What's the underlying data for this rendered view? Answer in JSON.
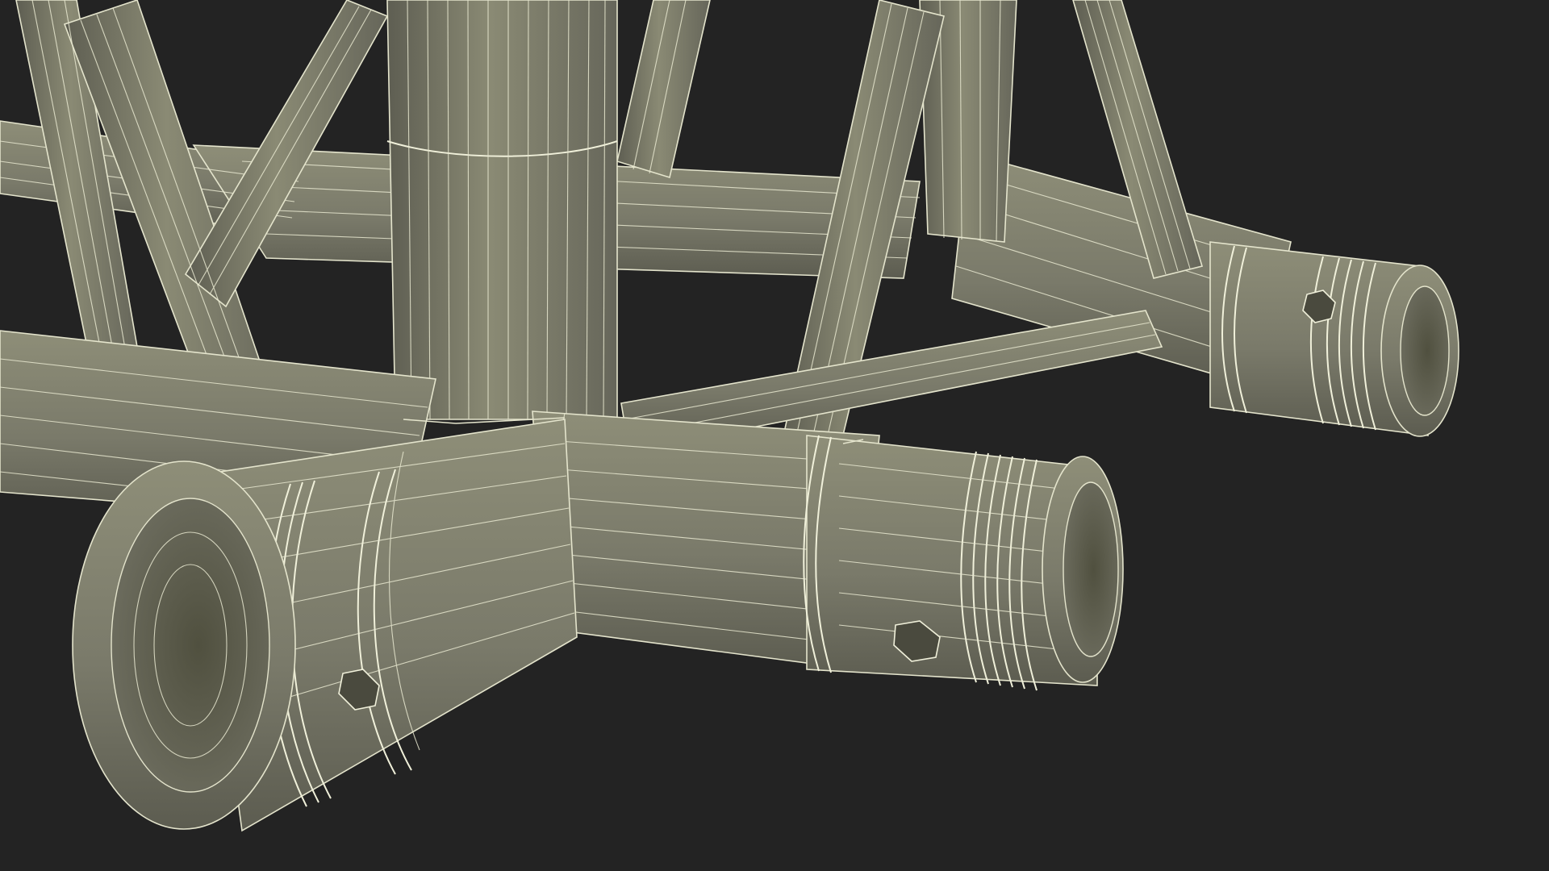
{
  "scene": {
    "subject": "wireframe-truss-junction",
    "colors": {
      "background": "#232323",
      "tube_light": "#8a8a74",
      "tube_mid": "#76766a",
      "tube_dark": "#5e5e52",
      "wire": "#e8e8d0",
      "bore_inner": "#3c3c34"
    }
  }
}
